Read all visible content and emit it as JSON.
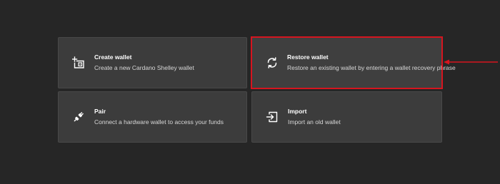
{
  "colors": {
    "background": "#262626",
    "card": "#3c3c3c",
    "highlight": "#d6151f",
    "title_text": "#ffffff",
    "desc_text": "#d8d8d8"
  },
  "options": [
    {
      "id": "create",
      "icon": "add-wallet-icon",
      "title": "Create wallet",
      "description": "Create a new Cardano Shelley wallet"
    },
    {
      "id": "restore",
      "icon": "restore-icon",
      "title": "Restore wallet",
      "description": "Restore an existing wallet by entering a wallet recovery phrase",
      "highlighted": true
    },
    {
      "id": "pair",
      "icon": "plug-icon",
      "title": "Pair",
      "description": "Connect a hardware wallet to access your funds"
    },
    {
      "id": "import",
      "icon": "import-icon",
      "title": "Import",
      "description": "Import an old wallet"
    }
  ],
  "annotation": {
    "type": "arrow",
    "points_to": "restore"
  }
}
